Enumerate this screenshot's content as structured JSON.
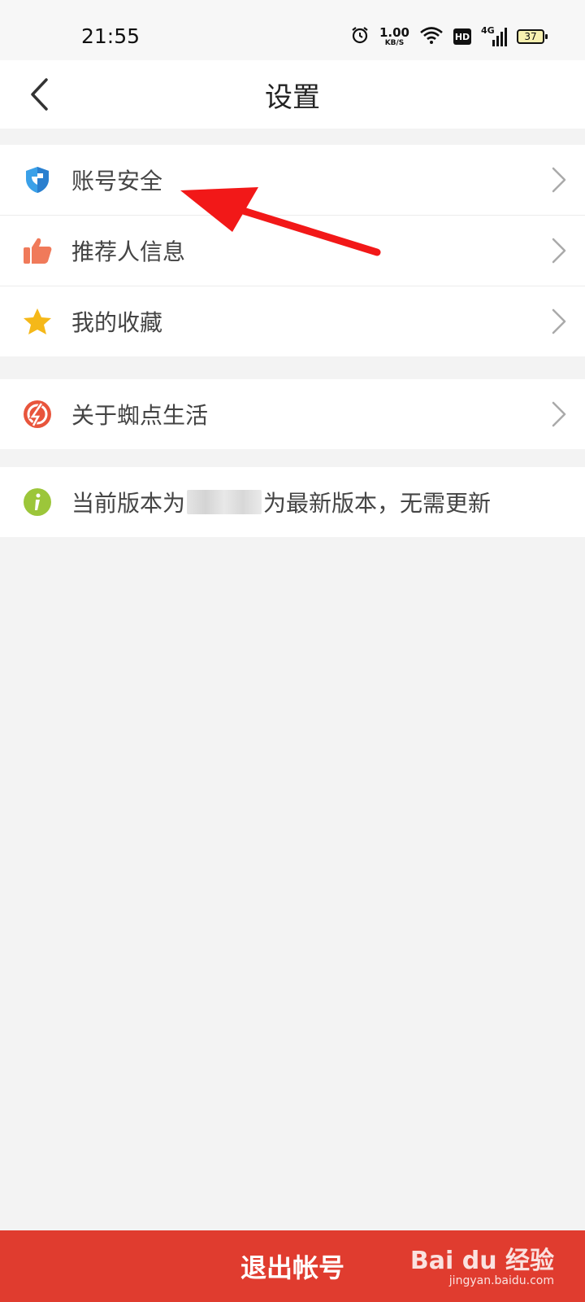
{
  "status_bar": {
    "time": "21:55",
    "speed_value": "1.00",
    "speed_unit": "KB/S",
    "hd_label": "HD",
    "network_label": "4G",
    "battery": "37",
    "icons": [
      "alarm-icon",
      "wifi-icon",
      "hd-icon",
      "signal-icon",
      "battery-icon"
    ]
  },
  "header": {
    "title": "设置",
    "back_icon": "chevron-left-icon"
  },
  "groups": [
    {
      "items": [
        {
          "label": "账号安全",
          "icon": "shield-icon",
          "color": "#3aa0e8"
        },
        {
          "label": "推荐人信息",
          "icon": "thumbs-up-icon",
          "color": "#f07a5a"
        },
        {
          "label": "我的收藏",
          "icon": "star-icon",
          "color": "#f5b819"
        }
      ]
    },
    {
      "items": [
        {
          "label": "关于蜘点生活",
          "icon": "app-logo-icon",
          "color": "#e8553c"
        }
      ]
    }
  ],
  "version": {
    "prefix": "当前版本为",
    "suffix": "为最新版本，无需更新",
    "icon": "info-icon",
    "color": "#9cc63a"
  },
  "logout": {
    "label": "退出帐号",
    "color": "#e03c2f"
  },
  "watermark": {
    "brand": "Bai du 经验",
    "site": "jingyan.baidu.com"
  },
  "colors": {
    "background": "#f3f3f3",
    "annotation_arrow": "#f21818"
  }
}
